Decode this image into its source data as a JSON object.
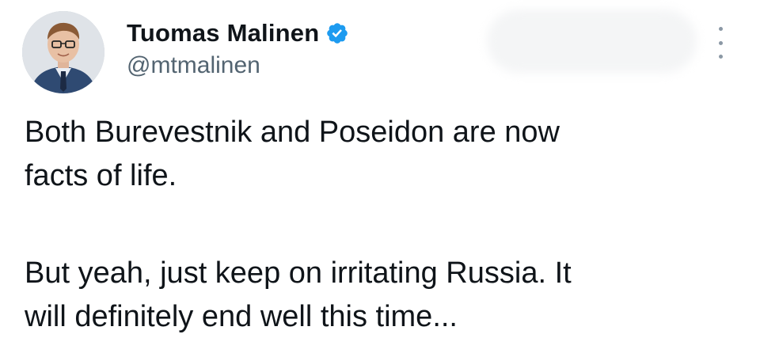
{
  "author": {
    "display_name": "Tuomas Malinen",
    "handle": "@mtmalinen",
    "verified": true,
    "verified_color": "#1d9bf0"
  },
  "tweet": {
    "paragraph_1_line_1": "Both Burevestnik and Poseidon are now",
    "paragraph_1_line_2": "facts of life.",
    "paragraph_2_line_1": "But yeah, just keep on irritating Russia. It",
    "paragraph_2_line_2": "will definitely end well this time..."
  },
  "icons": {
    "verified": "verified-badge-icon",
    "more": "more-options-icon"
  },
  "colors": {
    "text": "#0f1419",
    "secondary_text": "#536471",
    "background": "#ffffff"
  }
}
